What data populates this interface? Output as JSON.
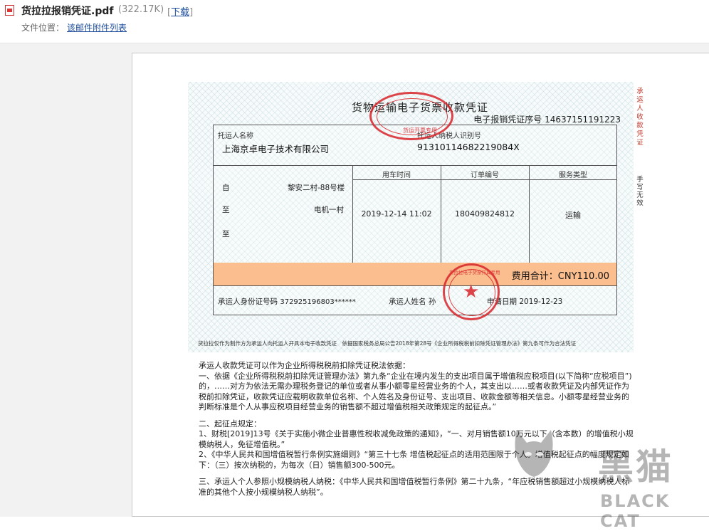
{
  "header": {
    "filename": "货拉拉报销凭证.pdf",
    "filesize": "(322.17K)",
    "download_label": "下载",
    "location_label": "文件位置：",
    "location_value": "该邮件附件列表"
  },
  "invoice": {
    "title": "货物运输电子货票收款凭证",
    "serial_label": "电子报销凭证序号",
    "serial_no": "14637151191223",
    "shipper_label": "托运人名称",
    "shipper_name": "上海京卓电子技术有限公司",
    "taxid_label": "托运人纳税人识别号",
    "taxid": "91310114682219084X",
    "col_time": "用车时间",
    "col_order": "订单编号",
    "col_service": "服务类型",
    "route_from_label": "自",
    "route_from": "黎安二村-88号楼",
    "route_to_label": "至",
    "route_to": "电机一村",
    "route_to2_label": "至",
    "time": "2019-12-14 11:02",
    "order_no": "180409824812",
    "service": "运输",
    "total_label": "费用合计：",
    "total_value": "CNY110.00",
    "carrier_id_label": "承运人身份证号码",
    "carrier_id": "372925196803******",
    "carrier_name_label": "承运人姓名",
    "carrier_name": "孙",
    "apply_date_label": "申请日期",
    "apply_date": "2019-12-23",
    "footnote": "货拉拉仅作为制作方为承运人向托运人开具本电子收款凭证　依据国家税务总局公告2018年第28号《企业所得税税前扣除凭证管理办法》第九条可作为合法凭证",
    "side_red": "承运人收款凭证",
    "side_black": "手写无效",
    "stamp1_text": "货运开票专用",
    "stamp2_text": "货拉拉电子货票开具专用"
  },
  "body": {
    "intro": "承运人收款凭证可以作为企业所得税税前扣除凭证税法依据：",
    "p1": "一、依据《企业所得税税前扣除凭证管理办法》第九条“企业在境内发生的支出项目属于增值税应税项目(以下简称“应税项目”)的，……对方为依法无需办理税务登记的单位或者从事小额零星经营业务的个人，其支出以……或者收款凭证及内部凭证作为税前扣除凭证，收款凭证应载明收款单位名称、个人姓名及身份证号、支出项目、收款金额等相关信息。小额零星经营业务的判断标准是个人从事应税项目经营业务的销售额不超过增值税相关政策规定的起征点。”",
    "p2_title": "二、起征点规定：",
    "p2_1": "1、财税[2019]13号《关于实施小微企业普惠性税收减免政策的通知》，“一、对月销售额10万元以下（含本数）的增值税小规模纳税人，免征增值税。”",
    "p2_2": "2、《中华人民共和国增值税暂行条例实施细则》“第三十七条 增值税起征点的适用范围限于个人。增值税起征点的幅度规定如下：（三）按次纳税的，为每次（日）销售额300-500元。",
    "p3": "三、承运人个人参照小规模纳税人纳税：《中华人民共和国增值税暂行条例》第二十九条，“年应税销售额超过小规模纳税人标准的其他个人按小规模纳税人纳税”。"
  },
  "watermark": {
    "title": "黑猫",
    "sub": "BLACK CAT"
  },
  "colors": {
    "total_bar": "#fbbe8e",
    "stamp_red": "#d8252b",
    "link_blue": "#1f4e9e"
  }
}
